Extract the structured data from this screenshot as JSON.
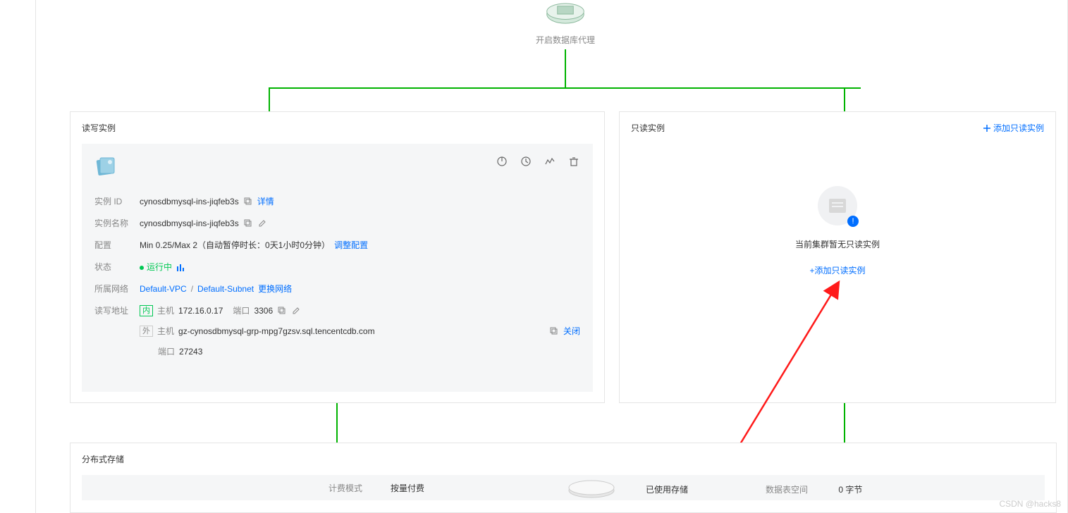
{
  "proxy": {
    "label": "开启数据库代理"
  },
  "rw": {
    "title": "读写实例",
    "fields": {
      "instance_id_label": "实例 ID",
      "instance_id": "cynosdbmysql-ins-jiqfeb3s",
      "details": "详情",
      "instance_name_label": "实例名称",
      "instance_name": "cynosdbmysql-ins-jiqfeb3s",
      "config_label": "配置",
      "config_value": "Min 0.25/Max 2（自动暂停时长：0天1小时0分钟）",
      "config_link": "调整配置",
      "status_label": "状态",
      "status_value": "运行中",
      "network_label": "所属网络",
      "network_vpc": "Default-VPC",
      "network_subnet": "Default-Subnet",
      "network_change": "更换网络",
      "addr_label": "读写地址",
      "addr_internal_badge": "内",
      "addr_internal_host_label": "主机",
      "addr_internal_host": "172.16.0.17",
      "addr_internal_port_label": "端口",
      "addr_internal_port": "3306",
      "addr_external_badge": "外",
      "addr_external_host_label": "主机",
      "addr_external_host": "gz-cynosdbmysql-grp-mpg7gzsv.sql.tencentcdb.com",
      "addr_external_port_label": "端口",
      "addr_external_port": "27243",
      "close_label": "关闭"
    }
  },
  "ro": {
    "title": "只读实例",
    "add_link_top": "添加只读实例",
    "empty_text": "当前集群暂无只读实例",
    "empty_link": "+添加只读实例"
  },
  "storage": {
    "title": "分布式存储",
    "billing_label": "计费模式",
    "billing_value": "按量付费",
    "used_label": "已使用存储",
    "table_space_label": "数据表空间",
    "table_space_value": "0 字节"
  },
  "watermark": "CSDN @hacks8"
}
